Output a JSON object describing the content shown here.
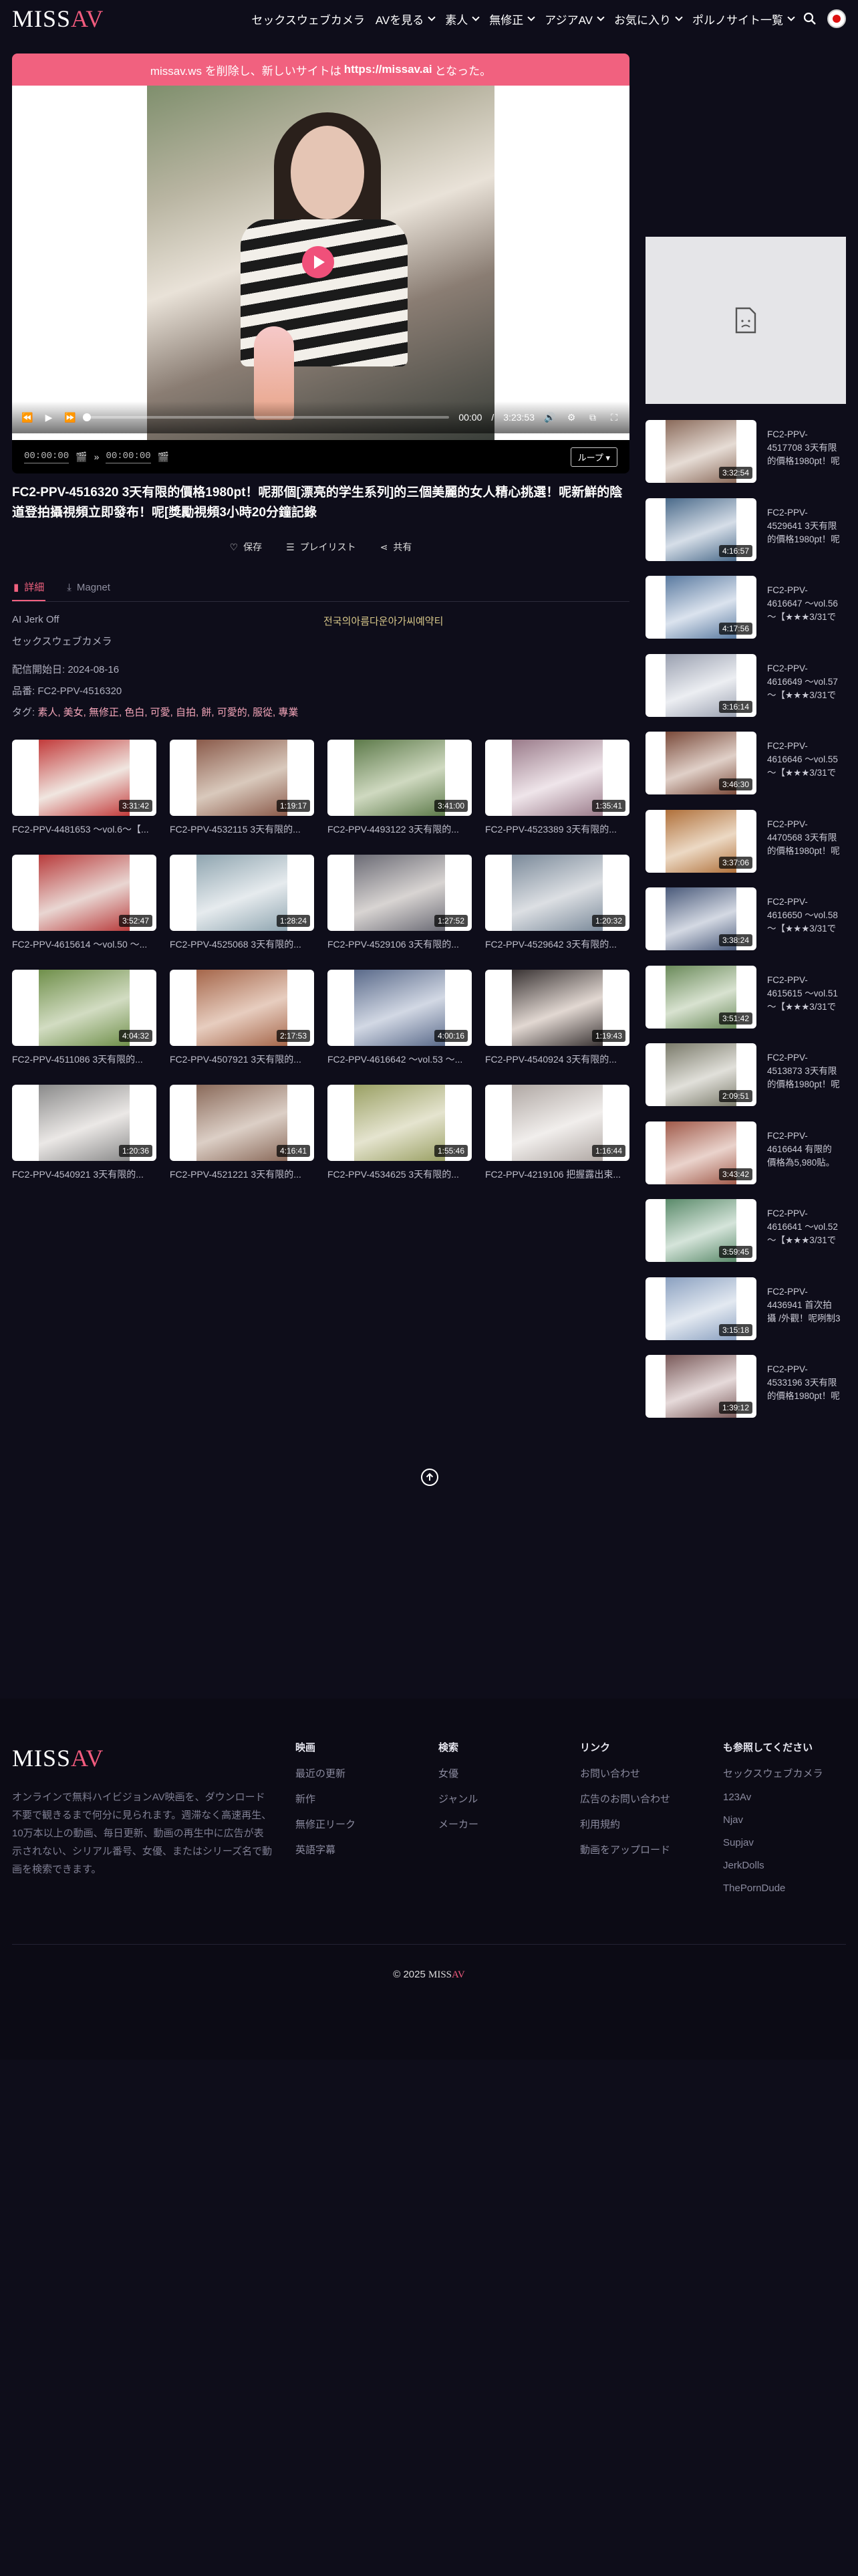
{
  "header": {
    "logo_main": "MISS",
    "logo_accent": "AV",
    "nav": [
      {
        "label": "セックスウェブカメラ",
        "dropdown": false
      },
      {
        "label": "AVを見る",
        "dropdown": true
      },
      {
        "label": "素人",
        "dropdown": true
      },
      {
        "label": "無修正",
        "dropdown": true
      },
      {
        "label": "アジアAV",
        "dropdown": true
      },
      {
        "label": "お気に入り",
        "dropdown": true
      },
      {
        "label": "ポルノサイト一覧",
        "dropdown": true
      }
    ]
  },
  "notice": {
    "prefix": "missav.ws を削除し、新しいサイトは",
    "url": "https://missav.ai",
    "suffix": "となった。"
  },
  "player": {
    "time_current": "00:00",
    "time_sep": "/",
    "time_total": "3:23:53",
    "progress": 0.0,
    "a_point": "00:00:00",
    "b_point": "00:00:00",
    "loop_label": "ループ"
  },
  "video": {
    "title": "FC2-PPV-4516320 3天有限的價格1980pt！呢那個[漂亮的学生系列]的三個美麗的女人精心挑選！呢新鮮的陰道登拍攝視頻立即發布！呢[獎勵視頻3小時20分鐘記錄",
    "actions": {
      "save": "保存",
      "playlist": "プレイリスト",
      "share": "共有"
    },
    "tabs": {
      "details": "詳細",
      "magnet": "Magnet"
    },
    "ai_label": "AI Jerk Off",
    "ad_text": "전국의아름다운아가씨예약티",
    "category_link": "セックスウェブカメラ",
    "release_label": "配信開始日:",
    "release_date": "2024-08-16",
    "code_label": "品番:",
    "code": "FC2-PPV-4516320",
    "tags_label": "タグ:",
    "tags": "素人, 美女, 無修正, 色白, 可愛, 自拍, 餅, 可愛的, 服從, 專業"
  },
  "grid": [
    {
      "title": "FC2-PPV-4481653 ～vol.6～【...",
      "duration": "3:31:42",
      "colors": [
        "#c23a3a",
        "#f0e6e0"
      ]
    },
    {
      "title": "FC2-PPV-4532115 3天有限的...",
      "duration": "1:19:17",
      "colors": [
        "#8a5a4a",
        "#d9c9bc"
      ]
    },
    {
      "title": "FC2-PPV-4493122 3天有限的...",
      "duration": "3:41:00",
      "colors": [
        "#5d7a4a",
        "#cfd9c0"
      ]
    },
    {
      "title": "FC2-PPV-4523389 3天有限的...",
      "duration": "1:35:41",
      "colors": [
        "#9a7b8a",
        "#efe5ea"
      ]
    },
    {
      "title": "FC2-PPV-4615614 ～vol.50 ～...",
      "duration": "3:52:47",
      "colors": [
        "#b83b3b",
        "#e9d6d2"
      ]
    },
    {
      "title": "FC2-PPV-4525068 3天有限的...",
      "duration": "1:28:24",
      "colors": [
        "#8fa5b0",
        "#e6ebee"
      ]
    },
    {
      "title": "FC2-PPV-4529106 3天有限的...",
      "duration": "1:27:52",
      "colors": [
        "#6b6b75",
        "#d8d4d2"
      ]
    },
    {
      "title": "FC2-PPV-4529642 3天有限的...",
      "duration": "1:20:32",
      "colors": [
        "#7b8a9a",
        "#dcdfe3"
      ]
    },
    {
      "title": "FC2-PPV-4511086 3天有限的...",
      "duration": "4:04:32",
      "colors": [
        "#6f8f4a",
        "#d2dcc2"
      ]
    },
    {
      "title": "FC2-PPV-4507921 3天有限的...",
      "duration": "2:17:53",
      "colors": [
        "#a5664a",
        "#e7cdbf"
      ]
    },
    {
      "title": "FC2-PPV-4616642 ～vol.53 ～...",
      "duration": "4:00:16",
      "colors": [
        "#5a6a8a",
        "#d2d8e4"
      ]
    },
    {
      "title": "FC2-PPV-4540924 3天有限的...",
      "duration": "1:19:43",
      "colors": [
        "#3a3434",
        "#e2d8d2"
      ]
    },
    {
      "title": "FC2-PPV-4540921 3天有限的...",
      "duration": "1:20:36",
      "colors": [
        "#8a8a8a",
        "#ebe8e6"
      ]
    },
    {
      "title": "FC2-PPV-4521221 3天有限的...",
      "duration": "4:16:41",
      "colors": [
        "#8a6a5a",
        "#dccfc6"
      ]
    },
    {
      "title": "FC2-PPV-4534625 3天有限的...",
      "duration": "1:55:46",
      "colors": [
        "#9aa064",
        "#e5e4cf"
      ]
    },
    {
      "title": "FC2-PPV-4219106 把握露出束...",
      "duration": "1:16:44",
      "colors": [
        "#b0a8a4",
        "#f1eeec"
      ]
    }
  ],
  "sidebar": [
    {
      "title_lines": [
        "FC2-PPV-",
        "4517708 3天有限",
        "的價格1980pt！呢"
      ],
      "duration": "3:32:54",
      "colors": [
        "#8a6a5a",
        "#e6dcd5"
      ]
    },
    {
      "title_lines": [
        "FC2-PPV-",
        "4529641 3天有限",
        "的價格1980pt！呢"
      ],
      "duration": "4:16:57",
      "colors": [
        "#4a6a8a",
        "#d6dee8"
      ]
    },
    {
      "title_lines": [
        "FC2-PPV-",
        "4616647 ～vol.56",
        "～【★★★3/31で"
      ],
      "duration": "4:17:56",
      "colors": [
        "#5a7aa0",
        "#dbe3ee"
      ]
    },
    {
      "title_lines": [
        "FC2-PPV-",
        "4616649 ～vol.57",
        "～【★★★3/31で"
      ],
      "duration": "3:16:14",
      "colors": [
        "#9aa0b0",
        "#eceef2"
      ]
    },
    {
      "title_lines": [
        "FC2-PPV-",
        "4616646 ～vol.55",
        "～【★★★3/31で"
      ],
      "duration": "3:46:30",
      "colors": [
        "#7a4a3a",
        "#e0d0c8"
      ]
    },
    {
      "title_lines": [
        "FC2-PPV-",
        "4470568 3天有限",
        "的價格1980pt！呢"
      ],
      "duration": "3:37:06",
      "colors": [
        "#b0703a",
        "#ecd9c4"
      ]
    },
    {
      "title_lines": [
        "FC2-PPV-",
        "4616650 ～vol.58",
        "～【★★★3/31で"
      ],
      "duration": "3:38:24",
      "colors": [
        "#4a5a7a",
        "#d4d9e3"
      ]
    },
    {
      "title_lines": [
        "FC2-PPV-",
        "4615615 ～vol.51",
        "～【★★★3/31で"
      ],
      "duration": "3:51:42",
      "colors": [
        "#6a8a5a",
        "#d8e2d0"
      ]
    },
    {
      "title_lines": [
        "FC2-PPV-",
        "4513873 3天有限",
        "的價格1980pt！呢"
      ],
      "duration": "2:09:51",
      "colors": [
        "#7a7a6a",
        "#e1e0da"
      ]
    },
    {
      "title_lines": [
        "FC2-PPV-",
        "4616644 有限的",
        "價格為5,980貼。"
      ],
      "duration": "3:43:42",
      "colors": [
        "#a05a4a",
        "#ead3cc"
      ]
    },
    {
      "title_lines": [
        "FC2-PPV-",
        "4616641 ～vol.52",
        "～【★★★3/31で"
      ],
      "duration": "3:59:45",
      "colors": [
        "#5a8a6a",
        "#d5e4da"
      ]
    },
    {
      "title_lines": [
        "FC2-PPV-",
        "4436941 首次拍",
        "攝 /外觀！呢咧制3"
      ],
      "duration": "3:15:18",
      "colors": [
        "#8aa0c0",
        "#e3e9f1"
      ]
    },
    {
      "title_lines": [
        "FC2-PPV-",
        "4533196 3天有限",
        "的價格1980pt！呢"
      ],
      "duration": "1:39:12",
      "colors": [
        "#7a5a5a",
        "#e6dada"
      ]
    }
  ],
  "footer": {
    "logo_main": "MISS",
    "logo_accent": "AV",
    "description": "オンラインで無料ハイビジョンAV映画を、ダウンロード不要で観きるまで何分に見られます。週滞なく高速再生、10万本以上の動画、毎日更新、動画の再生中に広告が表示されない、シリアル番号、女優、またはシリーズ名で動画を検索できます。",
    "columns": [
      {
        "heading": "映画",
        "links": [
          "最近の更新",
          "新作",
          "無修正リーク",
          "英語字幕"
        ]
      },
      {
        "heading": "検索",
        "links": [
          "女優",
          "ジャンル",
          "メーカー"
        ]
      },
      {
        "heading": "リンク",
        "links": [
          "お問い合わせ",
          "広告のお問い合わせ",
          "利用規約",
          "動画をアップロード"
        ]
      },
      {
        "heading": "も参照してください",
        "links": [
          "セックスウェブカメラ",
          "123Av",
          "Njav",
          "Supjav",
          "JerkDolls",
          "ThePornDude"
        ]
      }
    ],
    "copyright_prefix": "© 2025",
    "brand_main": "MISS",
    "brand_accent": "AV"
  },
  "colors": {
    "accent": "#f1617f",
    "background": "#0e0d1a"
  }
}
